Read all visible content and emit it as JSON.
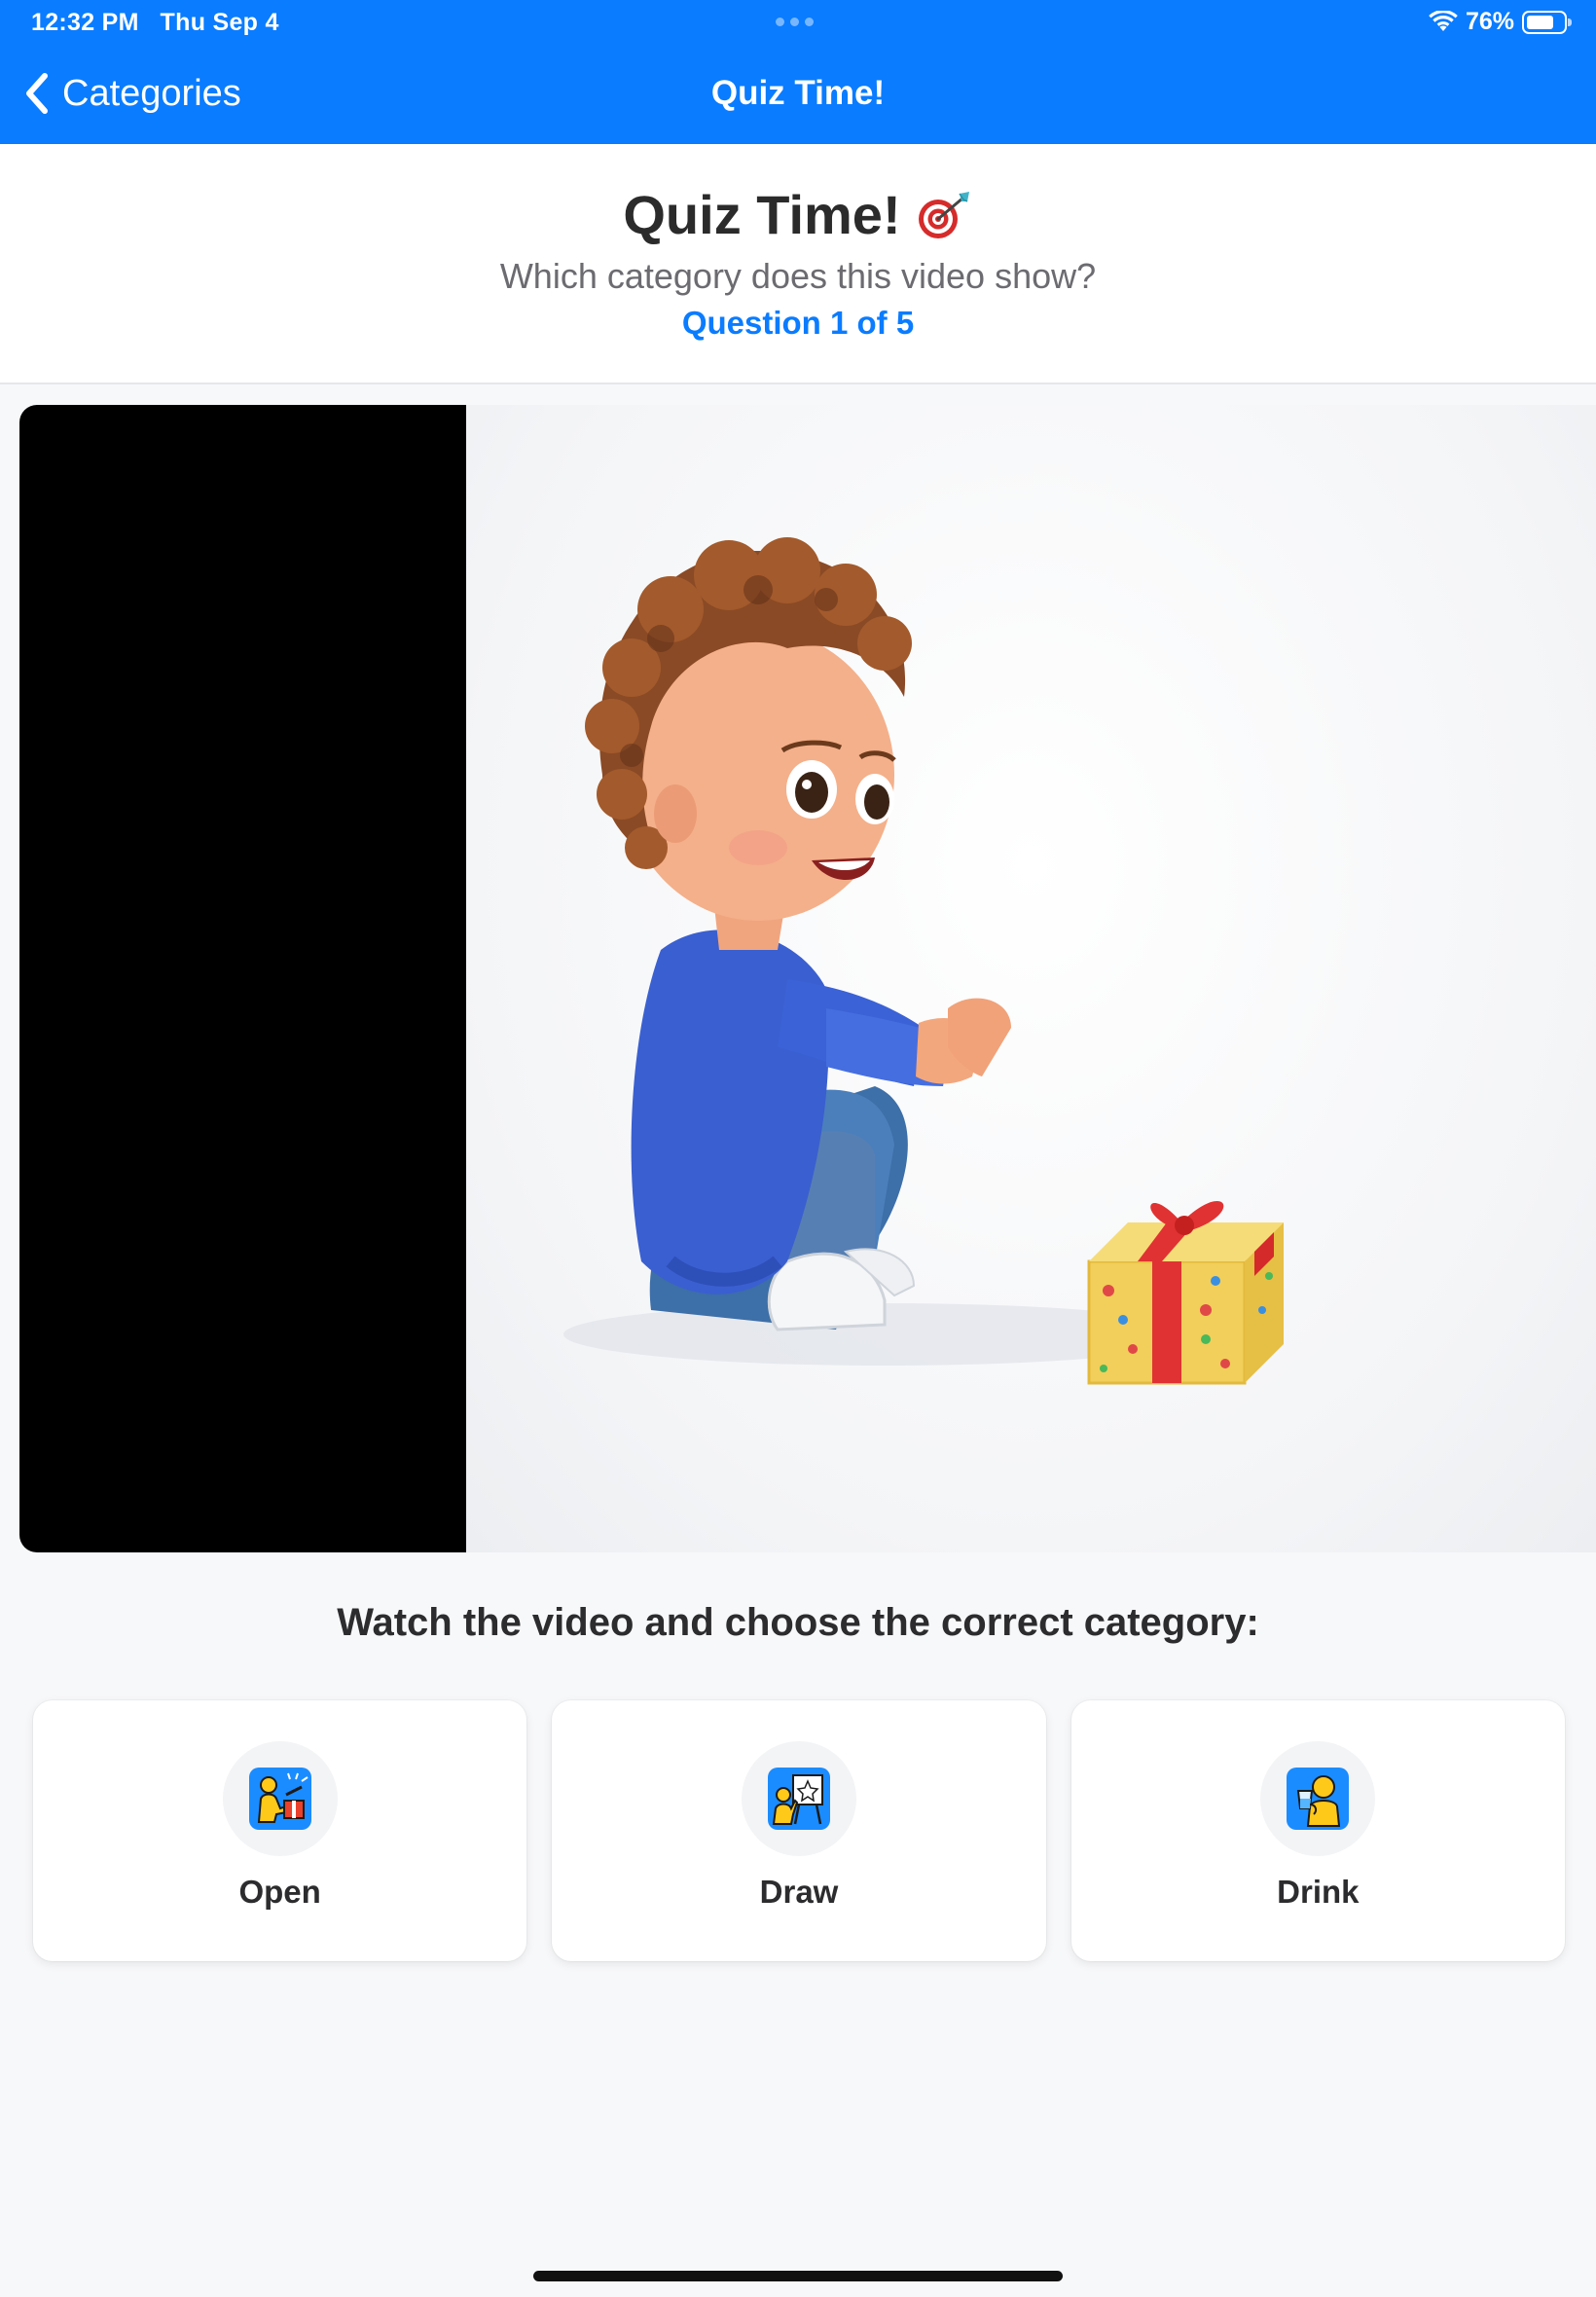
{
  "status_bar": {
    "time": "12:32 PM",
    "date": "Thu Sep 4",
    "battery_text": "76%",
    "battery_level": 0.76,
    "icons": [
      "wifi-icon",
      "battery-icon"
    ]
  },
  "nav": {
    "back_label": "Categories",
    "title": "Quiz Time!"
  },
  "quiz": {
    "title": "Quiz Time!",
    "title_icon": "target-dart-icon",
    "subtitle": "Which category does this video show?",
    "question_counter": "Question 1 of 5"
  },
  "video": {
    "content_description_icon": "child-with-gift-video-frame"
  },
  "instruction": "Watch the video and choose the correct category:",
  "options": [
    {
      "label": "Open",
      "icon": "open-gift-icon"
    },
    {
      "label": "Draw",
      "icon": "draw-easel-icon"
    },
    {
      "label": "Drink",
      "icon": "drink-cup-icon"
    }
  ],
  "colors": {
    "accent": "#0a7cff",
    "icon_bg": "#1a8cff",
    "figure_yellow": "#ffc91a",
    "background": "#f7f8fa",
    "text": "#2c2c2e",
    "subtext": "#6b6b70"
  }
}
